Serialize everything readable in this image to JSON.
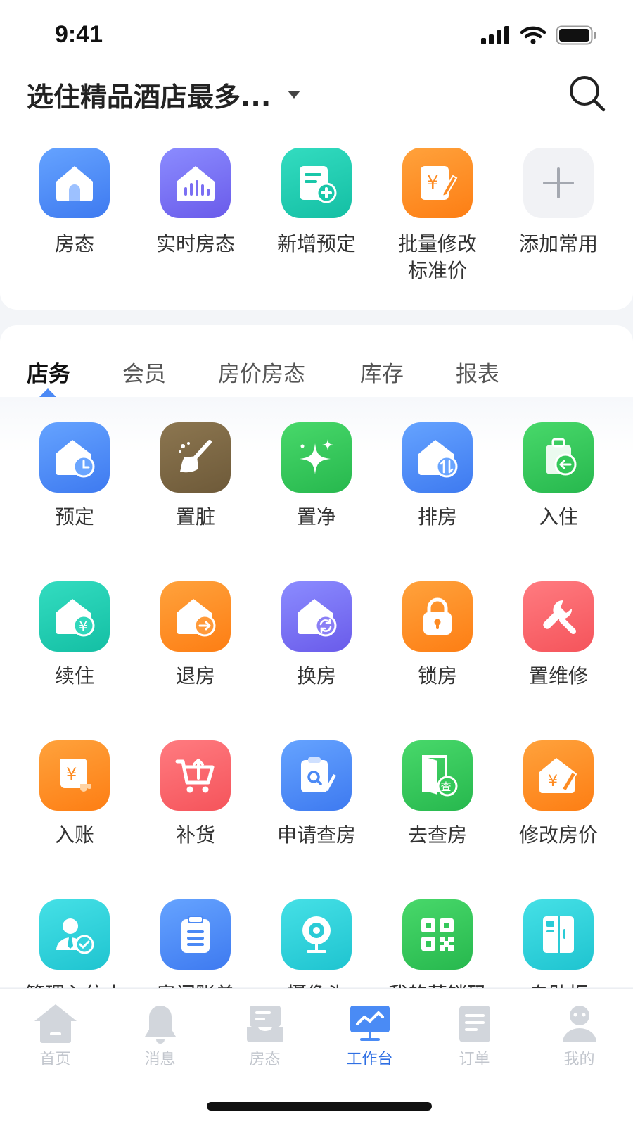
{
  "status_bar": {
    "time": "9:41"
  },
  "header": {
    "title": "选住精品酒店最多..."
  },
  "quick_actions": [
    {
      "label": "房态",
      "icon": "home-icon",
      "color": "#4b89f5"
    },
    {
      "label": "实时房态",
      "icon": "house-chart-icon",
      "color": "#7b6ff3"
    },
    {
      "label": "新增预定",
      "icon": "document-add-icon",
      "color": "#19c7a9"
    },
    {
      "label": "批量修改\n标准价",
      "icon": "price-edit-icon",
      "color": "#fd8b22"
    },
    {
      "label": "添加常用",
      "icon": "plus-icon",
      "color": "#f1f2f5"
    }
  ],
  "tabs": [
    {
      "label": "店务",
      "active": true
    },
    {
      "label": "会员"
    },
    {
      "label": "房价房态"
    },
    {
      "label": "库存"
    },
    {
      "label": "报表"
    }
  ],
  "grid": [
    {
      "label": "预定",
      "icon": "house-clock-icon"
    },
    {
      "label": "置脏",
      "icon": "broom-icon"
    },
    {
      "label": "置净",
      "icon": "sparkle-icon"
    },
    {
      "label": "排房",
      "icon": "house-sort-icon"
    },
    {
      "label": "入住",
      "icon": "luggage-checkin-icon"
    },
    {
      "label": "续住",
      "icon": "house-yen-icon"
    },
    {
      "label": "退房",
      "icon": "house-checkout-icon"
    },
    {
      "label": "换房",
      "icon": "house-swap-icon"
    },
    {
      "label": "锁房",
      "icon": "lock-icon"
    },
    {
      "label": "置维修",
      "icon": "wrench-icon"
    },
    {
      "label": "入账",
      "icon": "bill-yen-icon"
    },
    {
      "label": "补货",
      "icon": "cart-icon"
    },
    {
      "label": "申请查房",
      "icon": "clipboard-search-icon"
    },
    {
      "label": "去查房",
      "icon": "door-check-icon"
    },
    {
      "label": "修改房价",
      "icon": "house-price-edit-icon"
    },
    {
      "label": "管理入住人",
      "icon": "guest-manage-icon"
    },
    {
      "label": "房间账单",
      "icon": "clipboard-list-icon"
    },
    {
      "label": "摄像头",
      "icon": "camera-icon"
    },
    {
      "label": "我的营销码",
      "icon": "qr-code-icon"
    },
    {
      "label": "自助柜",
      "icon": "kiosk-icon"
    }
  ],
  "tabbar": [
    {
      "label": "首页",
      "icon": "home-icon"
    },
    {
      "label": "消息",
      "icon": "bell-icon"
    },
    {
      "label": "房态",
      "icon": "tray-icon"
    },
    {
      "label": "工作台",
      "icon": "dashboard-icon",
      "active": true
    },
    {
      "label": "订单",
      "icon": "document-icon"
    },
    {
      "label": "我的",
      "icon": "user-icon"
    }
  ]
}
